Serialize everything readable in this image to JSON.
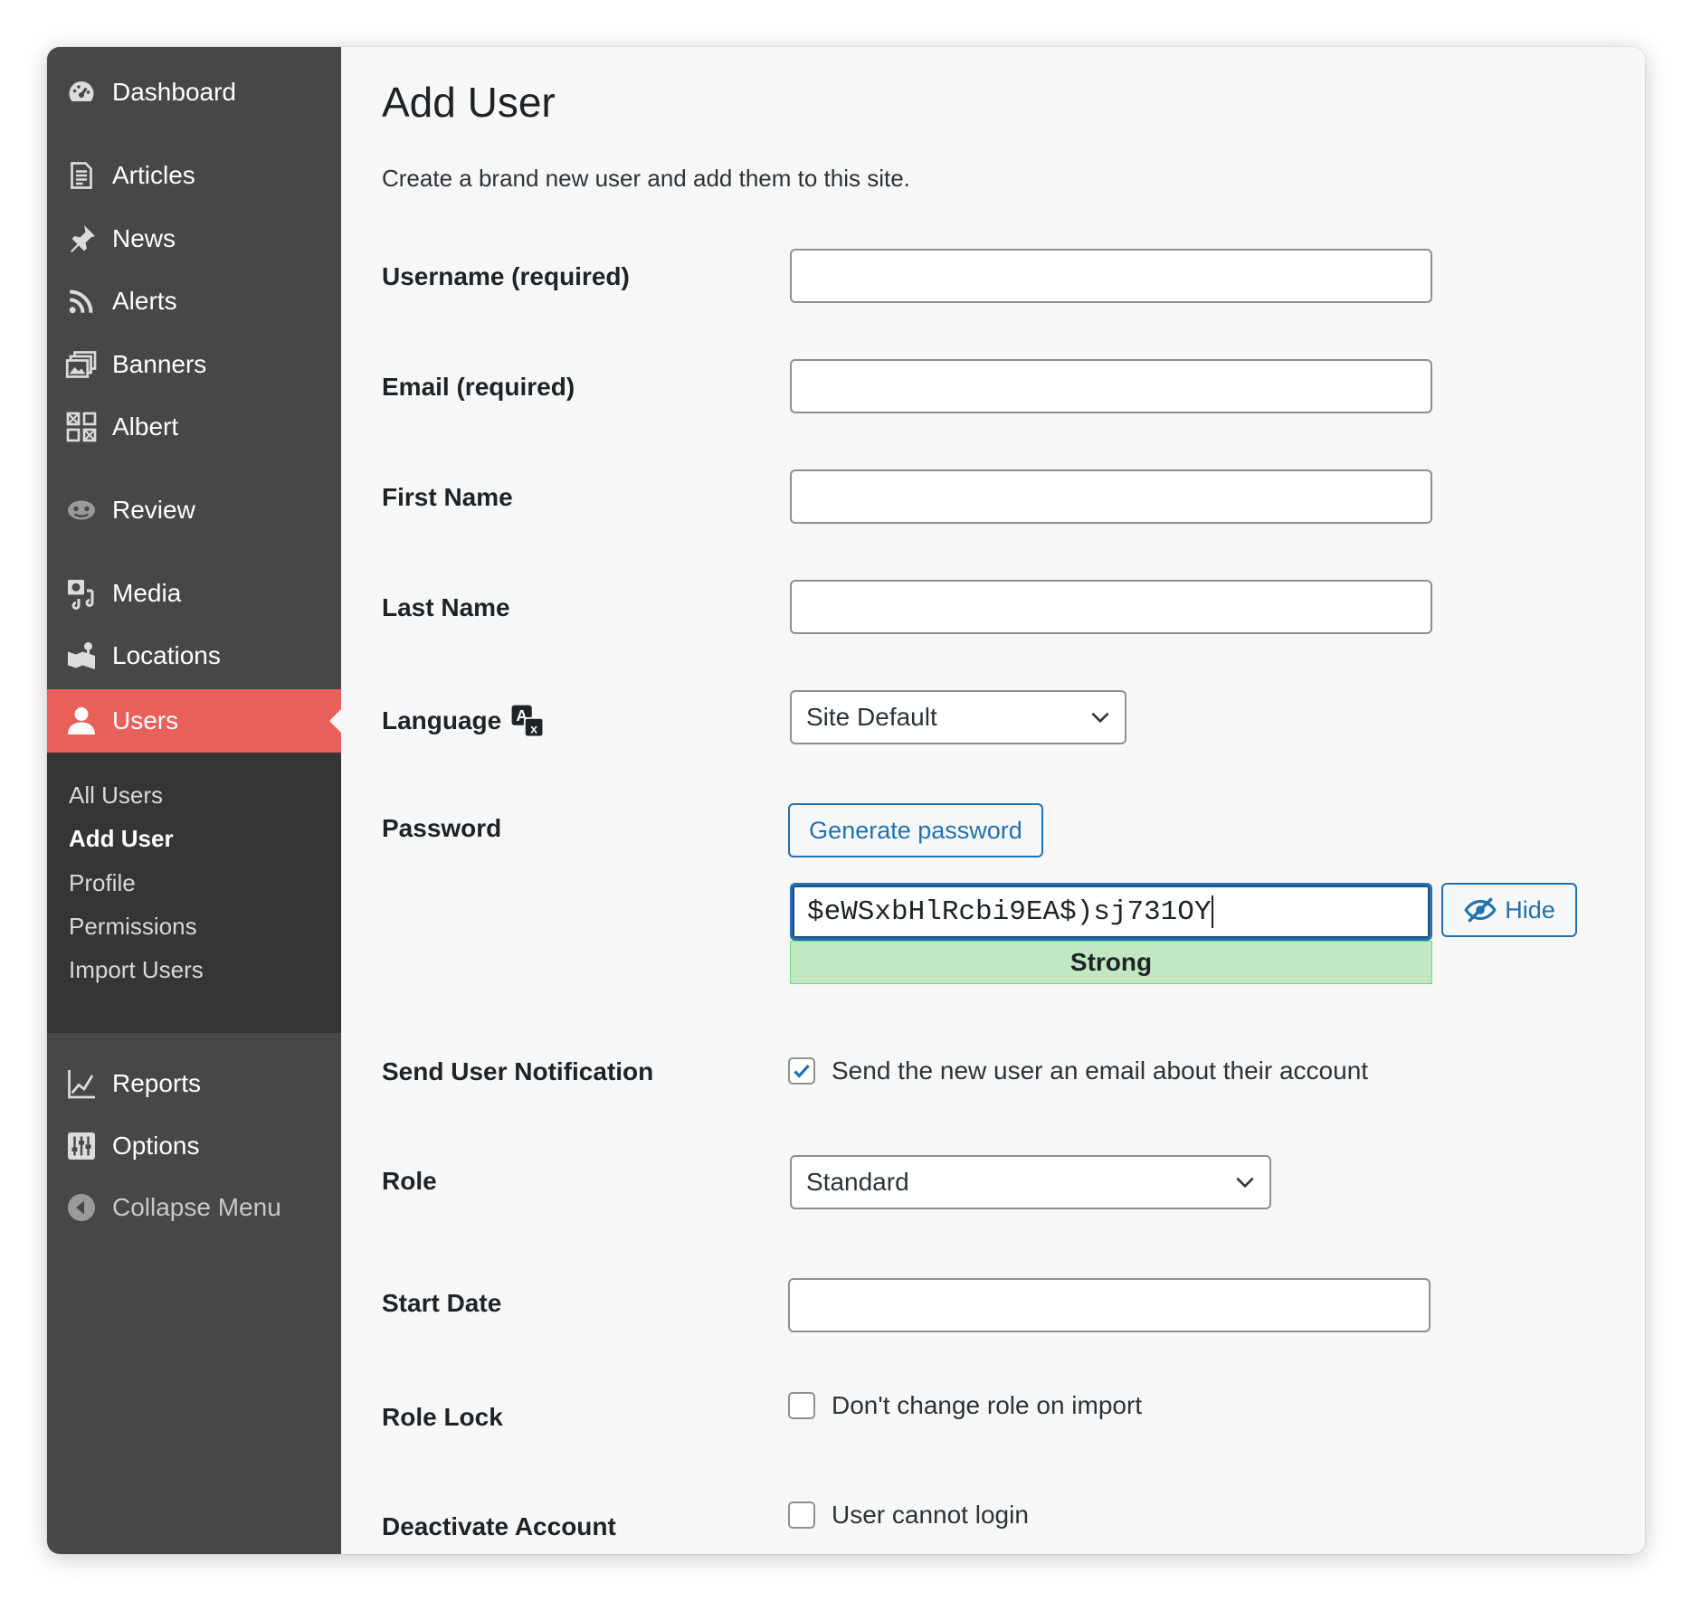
{
  "sidebar": {
    "items": [
      {
        "label": "Dashboard",
        "icon": "dashboard-icon"
      },
      {
        "label": "Articles",
        "icon": "document-icon"
      },
      {
        "label": "News",
        "icon": "pin-icon"
      },
      {
        "label": "Alerts",
        "icon": "rss-icon"
      },
      {
        "label": "Banners",
        "icon": "gallery-icon"
      },
      {
        "label": "Albert",
        "icon": "grid-icon"
      },
      {
        "label": "Review",
        "icon": "review-icon"
      },
      {
        "label": "Media",
        "icon": "media-icon"
      },
      {
        "label": "Locations",
        "icon": "locations-icon"
      },
      {
        "label": "Users",
        "icon": "user-icon"
      },
      {
        "label": "Reports",
        "icon": "chart-icon"
      },
      {
        "label": "Options",
        "icon": "sliders-icon"
      }
    ],
    "active": "Users",
    "submenu": [
      "All Users",
      "Add User",
      "Profile",
      "Permissions",
      "Import Users"
    ],
    "submenu_current": "Add User",
    "collapse_label": "Collapse Menu",
    "accent_color": "#e9605a"
  },
  "main": {
    "title": "Add User",
    "description": "Create a brand new user and add them to this site.",
    "fields": {
      "username": {
        "label": "Username (required)",
        "value": ""
      },
      "email": {
        "label": "Email (required)",
        "value": ""
      },
      "first_name": {
        "label": "First Name",
        "value": ""
      },
      "last_name": {
        "label": "Last Name",
        "value": ""
      },
      "language": {
        "label": "Language",
        "value": "Site Default"
      },
      "password": {
        "label": "Password",
        "generate_label": "Generate password",
        "value": "$eWSxbHlRcbi9EA$)sj731OY",
        "strength": "Strong",
        "hide_label": "Hide"
      },
      "notification": {
        "label": "Send User Notification",
        "checkbox_label": "Send the new user an email about their account",
        "checked": true
      },
      "role": {
        "label": "Role",
        "value": "Standard"
      },
      "start_date": {
        "label": "Start Date",
        "value": ""
      },
      "role_lock": {
        "label": "Role Lock",
        "checkbox_label": "Don't change role on import",
        "checked": false
      },
      "deactivate": {
        "label": "Deactivate Account",
        "checkbox_label": "User cannot login",
        "checked": false
      }
    }
  }
}
